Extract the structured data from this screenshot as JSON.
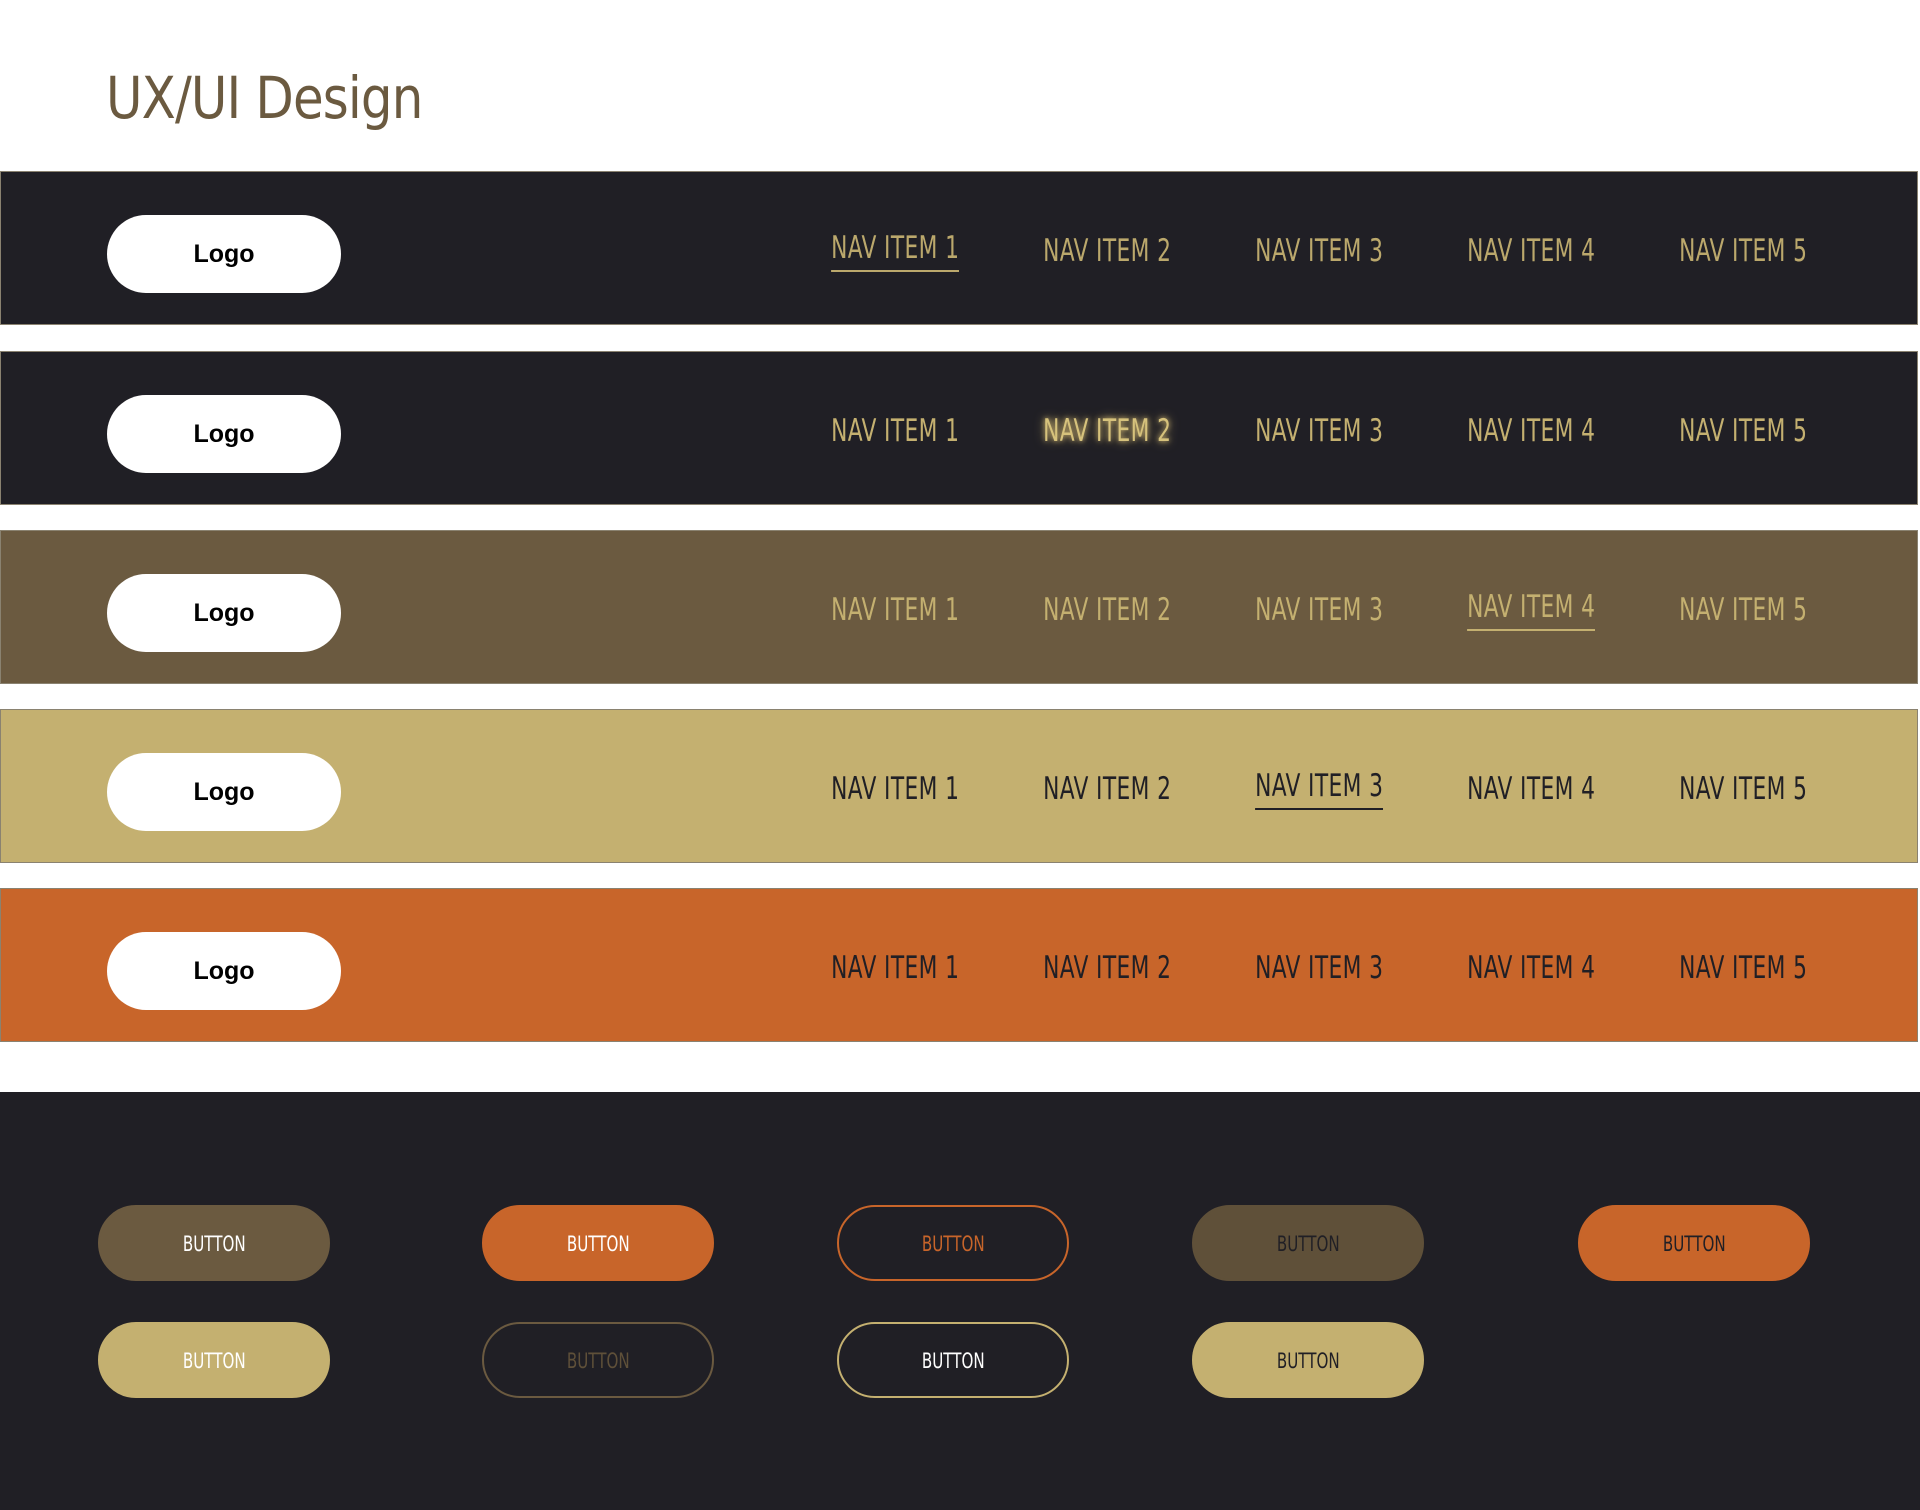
{
  "page": {
    "title": "UX/UI Design"
  },
  "colors": {
    "dark": "#201f25",
    "brown": "#6b5a40",
    "gold": "#c4b070",
    "orange": "#c8652a",
    "white": "#ffffff"
  },
  "navbars": [
    {
      "logo": "Logo",
      "items": [
        "NAV ITEM 1",
        "NAV ITEM 2",
        "NAV ITEM 3",
        "NAV ITEM 4",
        "NAV ITEM 5"
      ]
    },
    {
      "logo": "Logo",
      "items": [
        "NAV ITEM 1",
        "NAV ITEM 2",
        "NAV ITEM 3",
        "NAV ITEM 4",
        "NAV ITEM 5"
      ]
    },
    {
      "logo": "Logo",
      "items": [
        "NAV ITEM 1",
        "NAV ITEM 2",
        "NAV ITEM 3",
        "NAV ITEM 4",
        "NAV ITEM 5"
      ]
    },
    {
      "logo": "Logo",
      "items": [
        "NAV ITEM 1",
        "NAV ITEM 2",
        "NAV ITEM 3",
        "NAV ITEM 4",
        "NAV ITEM 5"
      ]
    },
    {
      "logo": "Logo",
      "items": [
        "NAV ITEM 1",
        "NAV ITEM 2",
        "NAV ITEM 3",
        "NAV ITEM 4",
        "NAV ITEM 5"
      ]
    }
  ],
  "buttons": [
    {
      "label": "BUTTON"
    },
    {
      "label": "BUTTON"
    },
    {
      "label": "BUTTON"
    },
    {
      "label": "BUTTON"
    },
    {
      "label": "BUTTON"
    },
    {
      "label": "BUTTON"
    },
    {
      "label": "BUTTON"
    },
    {
      "label": "BUTTON"
    },
    {
      "label": "BUTTON"
    }
  ]
}
